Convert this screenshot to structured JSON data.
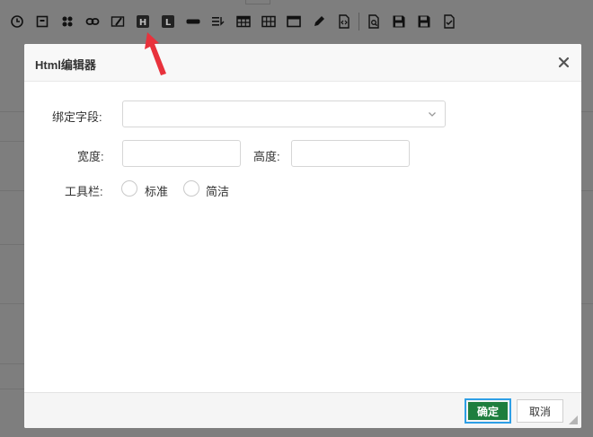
{
  "toolbar": {
    "icons": [
      "clock-icon",
      "frame-icon",
      "puzzle-icon",
      "link-icon",
      "edit-box-icon",
      "html-editor-icon",
      "label-icon",
      "textbox-icon",
      "text-align-icon",
      "table-icon",
      "grid-icon",
      "window-icon",
      "pencil-icon",
      "code-file-icon",
      "print-preview-icon",
      "save-icon",
      "save-as-icon",
      "checklist-icon"
    ],
    "html_icon_letter": "H",
    "label_icon_letter": "L"
  },
  "dialog": {
    "title": "Html编辑器",
    "form": {
      "field_label": "绑定字段:",
      "field_value": "",
      "width_label": "宽度:",
      "width_value": "",
      "height_label": "高度:",
      "height_value": "",
      "toolbar_label": "工具栏:",
      "toolbar_options": [
        "标准",
        "简洁"
      ]
    },
    "buttons": {
      "ok": "确定",
      "cancel": "取消"
    }
  },
  "colors": {
    "overlay": "#7e7e7e",
    "ok_button": "#1e7e3e",
    "focus_ring": "#2e9fe6",
    "arrow": "#e8323c"
  }
}
